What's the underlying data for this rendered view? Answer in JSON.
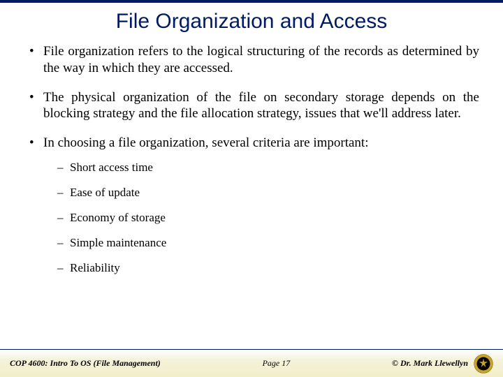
{
  "title": "File Organization and Access",
  "bullets": [
    {
      "text": "File organization refers to the logical structuring of the records as determined by the way in which they are accessed."
    },
    {
      "text": "The physical organization of the file on secondary storage depends on the blocking strategy and the file allocation strategy, issues that we'll address later."
    },
    {
      "text": "In choosing a file organization, several criteria are important:",
      "sub": [
        "Short access time",
        "Ease of update",
        "Economy of storage",
        "Simple maintenance",
        "Reliability"
      ]
    }
  ],
  "footer": {
    "course": "COP 4600: Intro To OS  (File Management)",
    "page": "Page  17",
    "author": "© Dr. Mark Llewellyn"
  }
}
